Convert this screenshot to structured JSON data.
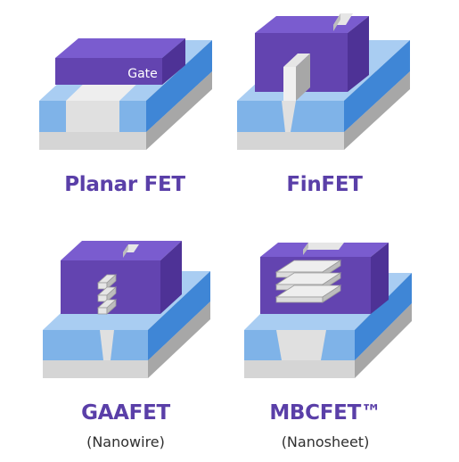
{
  "colors": {
    "gate_front": "#6344b0",
    "gate_top": "#7a5ccf",
    "gate_side": "#4e3296",
    "substrate_front": "#d5d5d5",
    "substrate_top": "#bdbdbd",
    "substrate_side": "#a7a7a7",
    "oxide_front": "#7fb3e8",
    "oxide_top": "#a9cdf2",
    "oxide_side": "#3f86d6",
    "channel": "#e6e6e6",
    "title_text": "#5a3fa8",
    "subtitle_text": "#2f2f2f"
  },
  "diagrams": [
    {
      "id": "planar",
      "title": "Planar FET",
      "subtitle": "",
      "gate_label": "Gate",
      "icon": "planar-fet-structure"
    },
    {
      "id": "finfet",
      "title": "FinFET",
      "subtitle": "",
      "icon": "finfet-structure"
    },
    {
      "id": "gaafet",
      "title": "GAAFET",
      "subtitle": "(Nanowire)",
      "icon": "gaafet-nanowire-structure"
    },
    {
      "id": "mbcfet",
      "title": "MBCFET™",
      "subtitle": "(Nanosheet)",
      "icon": "mbcfet-nanosheet-structure"
    }
  ]
}
